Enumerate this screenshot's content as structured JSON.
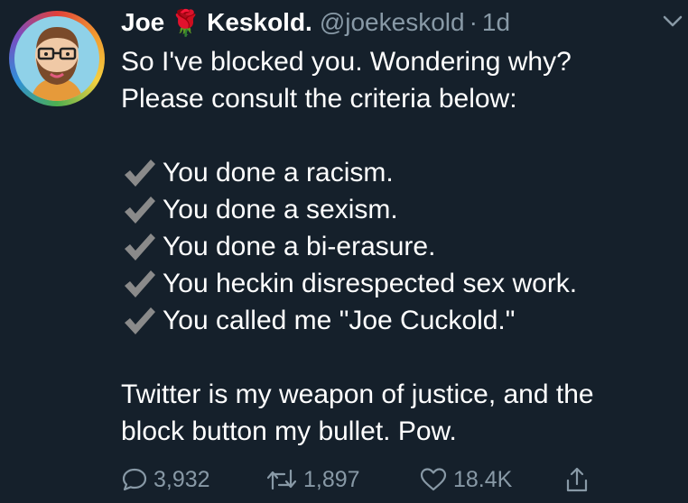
{
  "tweet": {
    "author_first": "Joe",
    "author_emoji": "🌹",
    "author_last": "Keskold.",
    "handle": "@joekeskold",
    "separator": "·",
    "time": "1d",
    "intro_line1": "So I've blocked you. Wondering why?",
    "intro_line2": "Please consult the criteria below:",
    "criteria": [
      "You done a racism.",
      "You done a sexism.",
      "You done a bi-erasure.",
      "You heckin disrespected sex work.",
      "You called me \"Joe Cuckold.\""
    ],
    "closing_line1": "Twitter is my weapon of justice, and the",
    "closing_line2": "block button my bullet. Pow."
  },
  "actions": {
    "replies": "3,932",
    "retweets": "1,897",
    "likes": "18.4K"
  },
  "icons": {
    "menu": "chevron-down-icon",
    "check": "heavy-check-mark-icon",
    "reply": "speech-bubble-icon",
    "retweet": "retweet-icon",
    "like": "heart-icon",
    "share": "share-icon"
  },
  "colors": {
    "background": "#15202b",
    "text": "#ffffff",
    "muted": "#8899a6",
    "check": "#8a8a8a"
  }
}
